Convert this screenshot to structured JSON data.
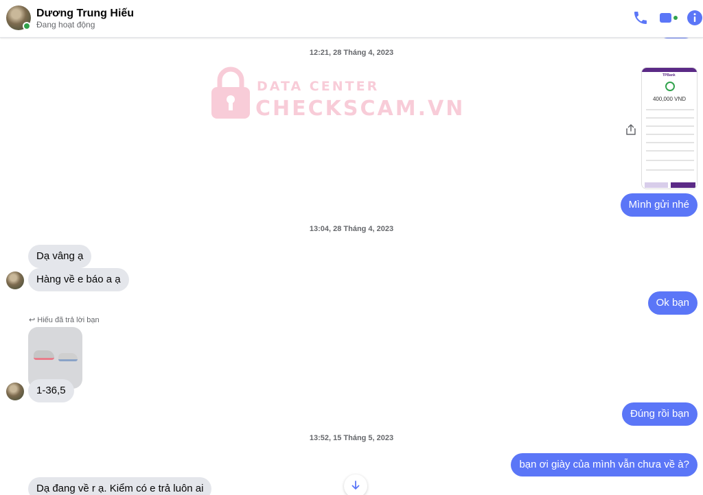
{
  "header": {
    "name": "Dương Trung Hiếu",
    "status": "Đang hoạt động",
    "icons": [
      "phone-icon",
      "video-icon",
      "info-icon"
    ],
    "accent": "#5b76f7"
  },
  "watermark": {
    "line1": "DATA CENTER",
    "line2": "CHECKSCAM.VN"
  },
  "messages": {
    "ts1": "12:21, 28 Tháng 4, 2023",
    "out1": "Mình gửi nhé",
    "ts2": "13:04, 28 Tháng 4, 2023",
    "in1": "Dạ vâng ạ",
    "in2": "Hàng về e báo a ạ",
    "out2": "Ok bạn",
    "reply_note": "Hiếu đã trả lời bạn",
    "in3": "1-36,5",
    "out3": "Đúng rồi bạn",
    "ts3": "13:52, 15 Tháng 5, 2023",
    "out4": "bạn ơi giày của mình vẫn chưa về à?",
    "in4": "Dạ đang về r ạ. Kiểm có e trả luôn ai"
  },
  "receipt": {
    "brand": "TPBank",
    "amount": "400,000 VND"
  },
  "colors": {
    "outgoing_bubble": "#5b76f7",
    "incoming_bubble": "#e4e6eb",
    "online": "#31a24c"
  }
}
